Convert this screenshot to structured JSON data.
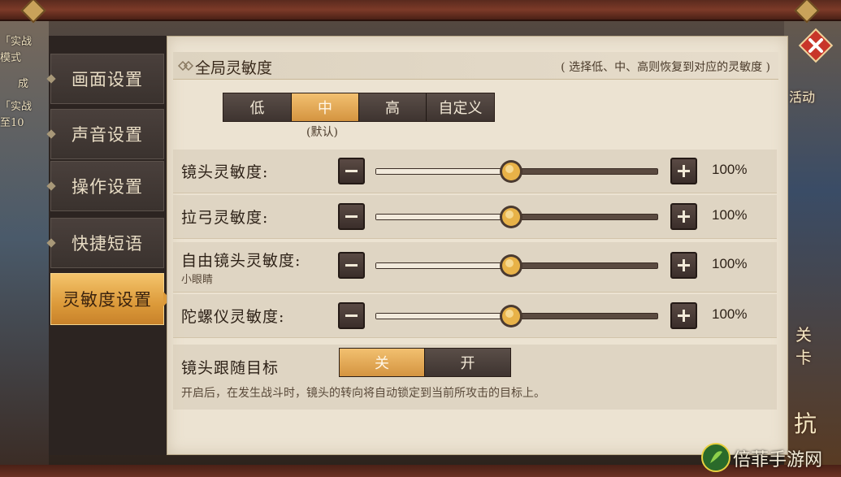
{
  "background_left": [
    "「实战",
    "模式",
    "成",
    "「实战",
    "至10"
  ],
  "background_right": [
    "活动",
    "关",
    "卡",
    "抗"
  ],
  "sidebar": {
    "items": [
      {
        "label": "画面设置",
        "active": false
      },
      {
        "label": "声音设置",
        "active": false
      },
      {
        "label": "操作设置",
        "active": false
      },
      {
        "label": "快捷短语",
        "active": false
      },
      {
        "label": "灵敏度设置",
        "active": true
      }
    ]
  },
  "global": {
    "title": "全局灵敏度",
    "hint": "( 选择低、中、高则恢复到对应的灵敏度 )",
    "options": [
      "低",
      "中",
      "高",
      "自定义"
    ],
    "selected": "中",
    "default_note": "(默认)"
  },
  "sliders": [
    {
      "label": "镜头灵敏度:",
      "value_text": "100%",
      "fraction": 0.48
    },
    {
      "label": "拉弓灵敏度:",
      "value_text": "100%",
      "fraction": 0.48
    },
    {
      "label": "自由镜头灵敏度:",
      "sublabel": "小眼睛",
      "value_text": "100%",
      "fraction": 0.48
    },
    {
      "label": "陀螺仪灵敏度:",
      "value_text": "100%",
      "fraction": 0.48
    }
  ],
  "camera_follow": {
    "label": "镜头跟随目标",
    "options": [
      "关",
      "开"
    ],
    "selected": "关",
    "description": "开启后，在发生战斗时，镜头的转向将自动锁定到当前所攻击的目标上。"
  },
  "watermark": {
    "text": "倍菲手游网"
  },
  "colors": {
    "accent": "#dc9a3a",
    "panel": "#ece3d2",
    "sidebar": "#2c2421",
    "close": "#c8362a"
  }
}
